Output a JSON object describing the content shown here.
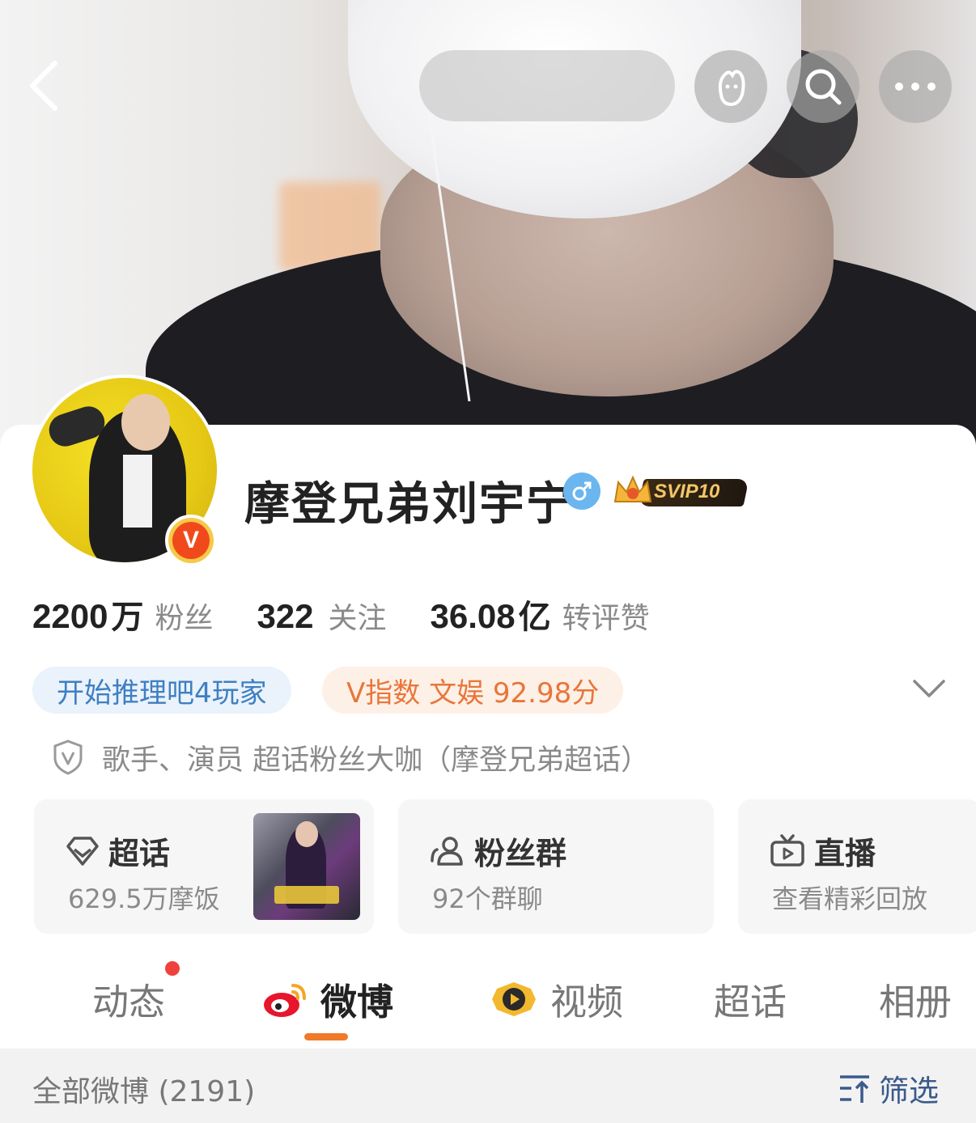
{
  "header": {
    "back_icon": "chevron-left-icon",
    "search_placeholder": "",
    "buttons": [
      {
        "icon": "pet-paw-icon"
      },
      {
        "icon": "search-icon"
      },
      {
        "icon": "more-icon"
      }
    ]
  },
  "profile": {
    "username": "摩登兄弟刘宇宁",
    "gender_icon": "male-icon",
    "gender_color": "#6bb6ee",
    "svip_label": "SVIP10",
    "verified_badge": "V",
    "stats": [
      {
        "value": "2200",
        "unit": "万",
        "label": "粉丝"
      },
      {
        "value": "322",
        "unit": "",
        "label": "关注"
      },
      {
        "value": "36.08",
        "unit": "亿",
        "label": "转评赞"
      }
    ],
    "tags": {
      "blue": "开始推理吧4玩家",
      "orange": "V指数 文娱 92.98分"
    },
    "verify_text": "歌手、演员 超话粉丝大咖（摩登兄弟超话）"
  },
  "cards": [
    {
      "title": "超话",
      "subtitle": "629.5万摩饭",
      "icon": "diamond-icon"
    },
    {
      "title": "粉丝群",
      "subtitle": "92个群聊",
      "icon": "group-icon"
    },
    {
      "title": "直播",
      "subtitle": "查看精彩回放",
      "icon": "tv-icon"
    }
  ],
  "tabs": [
    {
      "label": "动态"
    },
    {
      "label": "微博"
    },
    {
      "label": "视频"
    },
    {
      "label": "超话"
    },
    {
      "label": "相册"
    }
  ],
  "filter": {
    "left": "全部微博 (2191)",
    "right": "筛选"
  },
  "colors": {
    "accent_orange": "#f07a2a",
    "link_blue": "#3e7fc2",
    "badge_red": "#f0423c"
  }
}
